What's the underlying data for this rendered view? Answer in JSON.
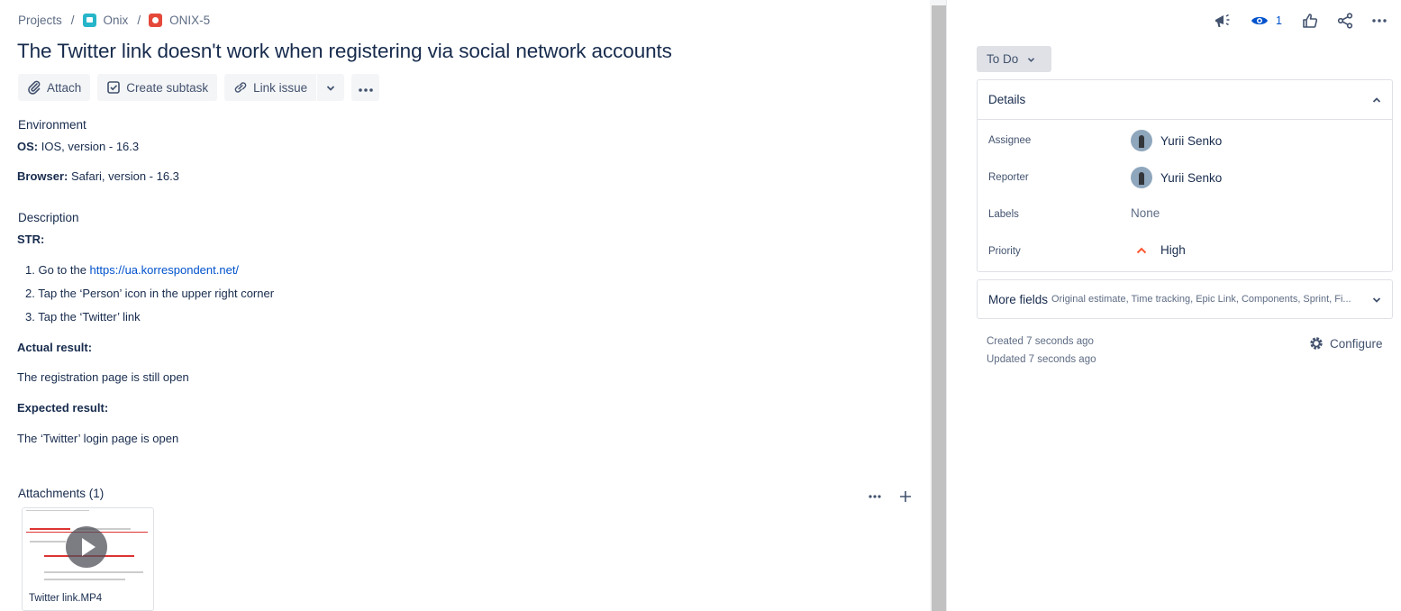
{
  "breadcrumb": {
    "projects": "Projects",
    "project": "Onix",
    "issue_key": "ONIX-5"
  },
  "issue": {
    "title": "The Twitter link doesn't work when registering via social network accounts"
  },
  "actions": {
    "attach": "Attach",
    "create_subtask": "Create subtask",
    "link_issue": "Link issue"
  },
  "environment": {
    "label": "Environment",
    "os_label": "OS:",
    "os_value": " IOS, version - 16.3",
    "browser_label": "Browser:",
    "browser_value": " Safari, version - 16.3"
  },
  "description": {
    "label": "Description",
    "str": "STR:",
    "steps": [
      {
        "prefix": "1. Go to the ",
        "link": "https://ua.korrespondent.net/"
      },
      {
        "text": "2. Tap the ‘Person’ icon in the upper right corner"
      },
      {
        "text": "3. Tap the ‘Twitter’ link"
      }
    ],
    "actual_label": "Actual result:",
    "actual_value": "The registration page is still open",
    "expected_label": "Expected result:",
    "expected_value": "The ‘Twitter’ login page is open"
  },
  "attachments": {
    "label": "Attachments (1)",
    "file_name": "Twitter link.MP4"
  },
  "sidebar": {
    "watchers_count": "1",
    "status": "To Do",
    "details": {
      "header": "Details",
      "assignee_label": "Assignee",
      "assignee": "Yurii Senko",
      "reporter_label": "Reporter",
      "reporter": "Yurii Senko",
      "labels_label": "Labels",
      "labels": "None",
      "priority_label": "Priority",
      "priority": "High"
    },
    "more_fields": {
      "title": "More fields",
      "subtitle": "Original estimate, Time tracking, Epic Link, Components, Sprint, Fi..."
    },
    "created": "Created 7 seconds ago",
    "updated": "Updated 7 seconds ago",
    "configure": "Configure"
  },
  "colors": {
    "link": "#0052cc",
    "priority_high": "#ff5630",
    "text": "#172b4d"
  }
}
